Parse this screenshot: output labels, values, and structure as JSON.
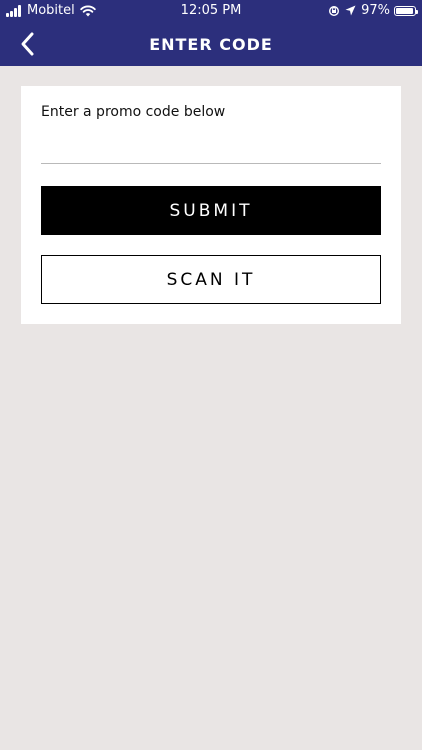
{
  "status_bar": {
    "carrier": "Mobitel",
    "time": "12:05 PM",
    "battery_percent": "97%",
    "battery_level": 0.97,
    "signal_bars": 4
  },
  "nav": {
    "title": "ENTER CODE",
    "back_icon": "chevron-left-icon"
  },
  "promo": {
    "label": "Enter a promo code below",
    "input_value": "",
    "input_placeholder": "",
    "submit_label": "SUBMIT",
    "scan_label": "SCAN IT"
  },
  "colors": {
    "nav_background": "#2c2f7c",
    "page_background": "#e9e5e4",
    "card_background": "#ffffff",
    "primary_button": "#000000"
  }
}
